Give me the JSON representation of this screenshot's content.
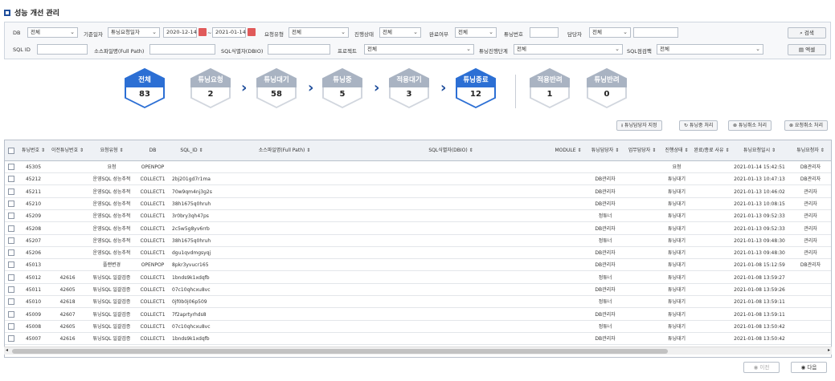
{
  "page": {
    "title": "성능 개선 관리"
  },
  "filters": {
    "db_label": "DB",
    "db_value": "전체",
    "basis_label": "기준일자",
    "basis_value": "튜닝요청일자",
    "date_from": "2020-12-14",
    "date_sep": "~",
    "date_to": "2021-01-14",
    "req_type_label": "요청유형",
    "req_type_value": "전체",
    "progress_label": "진행상태",
    "progress_value": "전체",
    "complete_label": "완료여부",
    "complete_value": "전체",
    "tuning_no_label": "튜닝번호",
    "tuning_no_value": "",
    "owner_label": "담당자",
    "owner_value": "전체",
    "owner_text": "",
    "sqlid_label": "SQL ID",
    "sqlid_value": "",
    "source_label": "소스파일명(Full Path)",
    "source_value": "",
    "sqlident_label": "SQL식별자(DBIO)",
    "sqlident_value": "",
    "project_label": "프로젝트",
    "project_value": "전체",
    "stage_label": "튜닝진행단계",
    "stage_value": "전체",
    "sqlcheck_label": "SQL점검팩",
    "sqlcheck_value": "전체",
    "search_button": "검색",
    "excel_button": "엑셀"
  },
  "pipeline": [
    {
      "label": "전체",
      "count": "83",
      "active": true
    },
    {
      "label": "튜닝요청",
      "count": "2",
      "active": false
    },
    {
      "label": "튜닝대기",
      "count": "58",
      "active": false
    },
    {
      "label": "튜닝중",
      "count": "5",
      "active": false
    },
    {
      "label": "적용대기",
      "count": "3",
      "active": false
    },
    {
      "label": "튜닝종료",
      "count": "12",
      "active": true
    },
    {
      "label": "적용반려",
      "count": "1",
      "active": false
    },
    {
      "label": "튜닝반려",
      "count": "0",
      "active": false
    }
  ],
  "actions": {
    "assign": "튜닝담당자 지정",
    "tuning_process": "튜닝중 처리",
    "tuning_cancel": "튜닝취소 처리",
    "request_cancel": "요청취소 처리"
  },
  "table": {
    "headers": [
      "튜닝번호 ⇕",
      "이전튜닝번호 ⇕",
      "요청유형 ⇕",
      "DB",
      "SQL_ID ⇕",
      "소스파일명(Full Path) ⇕",
      "SQL식별자(DBIO) ⇕",
      "MODULE ⇕",
      "튜닝담당자 ⇕",
      "업무담당자 ⇕",
      "진행상태 ⇕",
      "완료/종료 사유 ⇕",
      "튜닝요청일시 ⇕",
      "튜닝요청자 ⇕"
    ],
    "rows": [
      [
        "45305",
        "",
        "요청",
        "OPENPOP",
        "",
        "",
        "",
        "",
        "",
        "",
        "요청",
        "",
        "2021-01-14 15:42:51",
        "DB관리자"
      ],
      [
        "45212",
        "",
        "운영SQL 성능추적",
        "COLLECT1",
        "2bj201gd7r1ma",
        "",
        "",
        "",
        "DB관리자",
        "",
        "튜닝대기",
        "",
        "2021-01-13 10:47:13",
        "DB관리자"
      ],
      [
        "45211",
        "",
        "운영SQL 성능추적",
        "COLLECT1",
        "70w9qm4nj3g2s",
        "",
        "",
        "",
        "DB관리자",
        "",
        "튜닝대기",
        "",
        "2021-01-13 10:46:02",
        "관리자"
      ],
      [
        "45210",
        "",
        "운영SQL 성능추적",
        "COLLECT1",
        "38h1675q0hruh",
        "",
        "",
        "",
        "DB관리자",
        "",
        "튜닝대기",
        "",
        "2021-01-13 10:08:15",
        "관리자"
      ],
      [
        "45209",
        "",
        "운영SQL 성능추적",
        "COLLECT1",
        "3r0bry3qh47ps",
        "",
        "",
        "",
        "정튜너",
        "",
        "튜닝대기",
        "",
        "2021-01-13 09:52:33",
        "관리자"
      ],
      [
        "45208",
        "",
        "운영SQL 성능추적",
        "COLLECT1",
        "2c5w5g8yv6rrb",
        "",
        "",
        "",
        "DB관리자",
        "",
        "튜닝대기",
        "",
        "2021-01-13 09:52:33",
        "관리자"
      ],
      [
        "45207",
        "",
        "운영SQL 성능추적",
        "COLLECT1",
        "38h1675q0hruh",
        "",
        "",
        "",
        "정튜너",
        "",
        "튜닝대기",
        "",
        "2021-01-13 09:48:30",
        "관리자"
      ],
      [
        "45206",
        "",
        "운영SQL 성능추적",
        "COLLECT1",
        "dgu1qvdmgsyqj",
        "",
        "",
        "",
        "DB관리자",
        "",
        "튜닝대기",
        "",
        "2021-01-13 09:48:30",
        "관리자"
      ],
      [
        "45013",
        "",
        "플랜변경",
        "OPENPOP",
        "8pkr3yvucr165",
        "",
        "",
        "",
        "DB관리자",
        "",
        "튜닝대기",
        "",
        "2021-01-08 15:12:59",
        "DB관리자"
      ],
      [
        "45012",
        "42616",
        "튜닝SQL 일괄검증",
        "COLLECT1",
        "1bnds9k1xdqfb",
        "",
        "",
        "",
        "정튜너",
        "",
        "튜닝대기",
        "",
        "2021-01-08 13:59:27",
        ""
      ],
      [
        "45011",
        "42605",
        "튜닝SQL 일괄검증",
        "COLLECT1",
        "07c10qhcxu8vc",
        "",
        "",
        "",
        "DB관리자",
        "",
        "튜닝대기",
        "",
        "2021-01-08 13:59:26",
        ""
      ],
      [
        "45010",
        "42618",
        "튜닝SQL 일괄검증",
        "COLLECT1",
        "0jf0b0j06p509",
        "",
        "",
        "",
        "정튜너",
        "",
        "튜닝대기",
        "",
        "2021-01-08 13:59:11",
        ""
      ],
      [
        "45009",
        "42607",
        "튜닝SQL 일괄검증",
        "COLLECT1",
        "7f2aprtyrhds8",
        "",
        "",
        "",
        "DB관리자",
        "",
        "튜닝대기",
        "",
        "2021-01-08 13:59:11",
        ""
      ],
      [
        "45008",
        "42605",
        "튜닝SQL 일괄검증",
        "COLLECT1",
        "07c10qhcxu8vc",
        "",
        "",
        "",
        "정튜너",
        "",
        "튜닝대기",
        "",
        "2021-01-08 13:50:42",
        ""
      ],
      [
        "45007",
        "42616",
        "튜닝SQL 일괄검증",
        "COLLECT1",
        "1bnds9k1xdqfb",
        "",
        "",
        "",
        "DB관리자",
        "",
        "튜닝대기",
        "",
        "2021-01-08 13:50:42",
        ""
      ]
    ]
  },
  "pager": {
    "prev": "이전",
    "next": "다음"
  },
  "colors": {
    "accent": "#2c6fd4",
    "inactive_hex": "#a9b3c2",
    "chevron": "#1f4e9c"
  }
}
